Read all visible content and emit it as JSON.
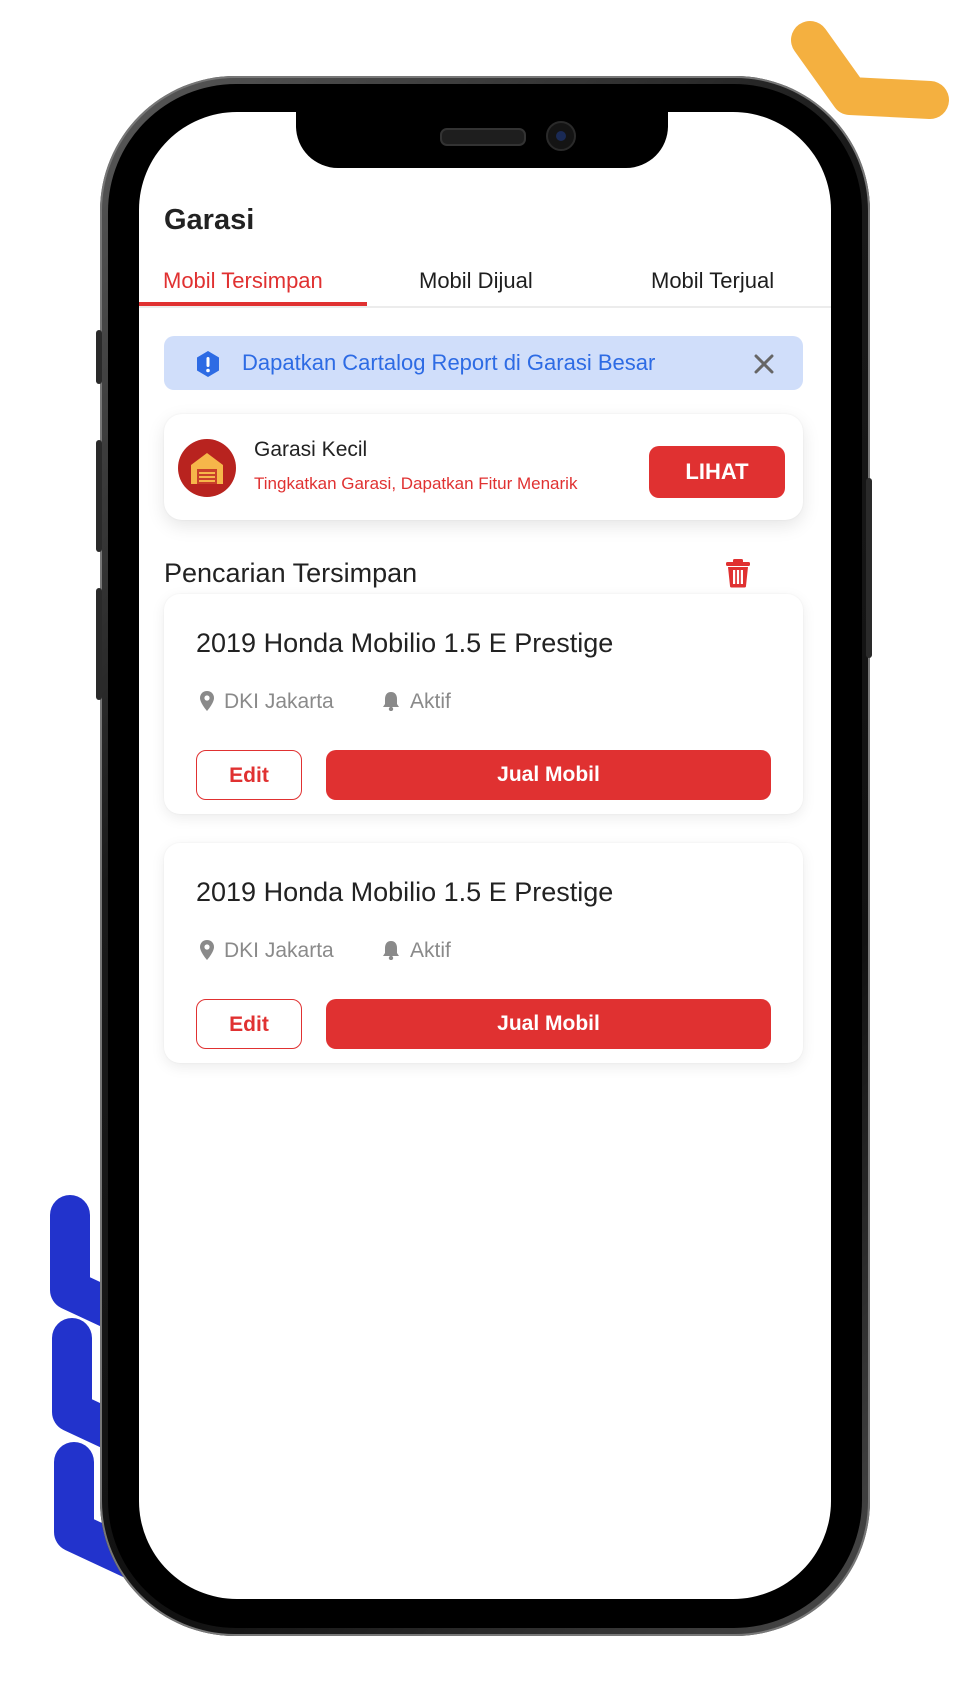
{
  "page": {
    "title": "Garasi"
  },
  "tabs": [
    {
      "label": "Mobil Tersimpan",
      "active": true
    },
    {
      "label": "Mobil Dijual",
      "active": false
    },
    {
      "label": "Mobil Terjual",
      "active": false
    }
  ],
  "banner": {
    "icon": "alert-icon",
    "text": "Dapatkan Cartalog Report di Garasi Besar",
    "close_icon": "close-icon"
  },
  "promo": {
    "icon": "garage-icon",
    "title": "Garasi Kecil",
    "subtitle": "Tingkatkan Garasi, Dapatkan Fitur Menarik",
    "button": "LIHAT"
  },
  "saved_searches": {
    "title": "Pencarian Tersimpan",
    "delete_icon": "trash-icon",
    "items": [
      {
        "title": "2019 Honda Mobilio 1.5 E Prestige",
        "location": "DKI Jakarta",
        "status": "Aktif",
        "edit_label": "Edit",
        "sell_label": "Jual Mobil"
      },
      {
        "title": "2019 Honda Mobilio 1.5 E Prestige",
        "location": "DKI Jakarta",
        "status": "Aktif",
        "edit_label": "Edit",
        "sell_label": "Jual Mobil"
      }
    ]
  },
  "colors": {
    "accent": "#e03131",
    "banner_bg": "#d0defa",
    "banner_text": "#2d6be4",
    "deco_yellow": "#f4b040",
    "deco_blue": "#2233cc"
  }
}
